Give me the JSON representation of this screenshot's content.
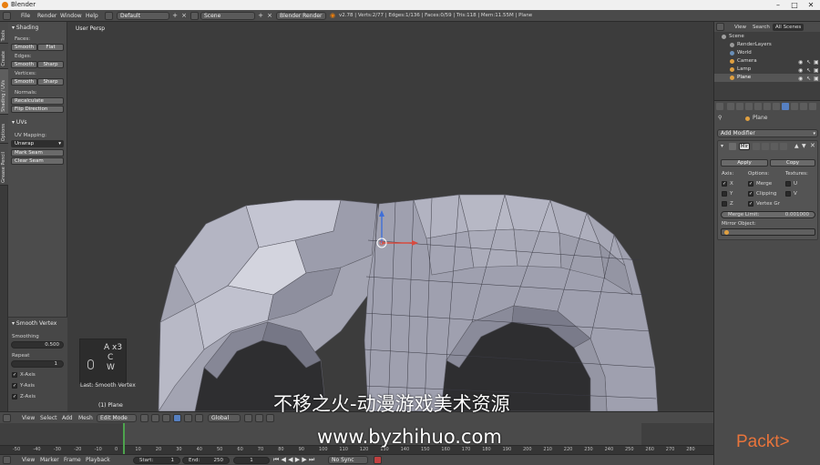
{
  "window": {
    "title": "Blender"
  },
  "infobar": {
    "menus": [
      "File",
      "Render",
      "Window",
      "Help"
    ],
    "layout": "Default",
    "scene": "Scene",
    "engine": "Blender Render",
    "stats": "v2.78 | Verts:2/77 | Edges:1/136 | Faces:0/59 | Tris:118 | Mem:11.55M | Plane"
  },
  "left_tabs": [
    "Tools",
    "Create",
    "Shading / UVs",
    "Options",
    "Grease Pencil"
  ],
  "toolshelf": {
    "shading_header": "Shading",
    "faces_label": "Faces:",
    "faces_smooth": "Smooth",
    "faces_flat": "Flat",
    "edges_label": "Edges:",
    "edges_smooth": "Smooth",
    "edges_sharp": "Sharp",
    "vertices_label": "Vertices:",
    "vertices_smooth": "Smooth",
    "vertices_sharp": "Sharp",
    "normals_label": "Normals:",
    "recalculate": "Recalculate",
    "flip_direction": "Flip Direction",
    "uvs_header": "UVs",
    "uv_mapping_label": "UV Mapping:",
    "unwrap": "Unwrap",
    "mark_seam": "Mark Seam",
    "clear_seam": "Clear Seam",
    "operator_header": "Smooth Vertex",
    "smoothing_label": "Smoothing",
    "smoothing_value": "0.500",
    "repeat_label": "Repeat",
    "repeat_value": "1",
    "x_axis": "X-Axis",
    "y_axis": "Y-Axis",
    "z_axis": "Z-Axis"
  },
  "viewport": {
    "view_name": "User Persp",
    "object_name": "(1) Plane",
    "keys": [
      "A x3",
      "C",
      "W"
    ],
    "last_op": "Last: Smooth Vertex"
  },
  "viewport_header": {
    "view": "View",
    "select": "Select",
    "add": "Add",
    "mesh": "Mesh",
    "mode": "Edit Mode",
    "orientation": "Global"
  },
  "timeline": {
    "ticks": [
      "-50",
      "-40",
      "-30",
      "-20",
      "-10",
      "0",
      "10",
      "20",
      "30",
      "40",
      "50",
      "60",
      "70",
      "80",
      "90",
      "100",
      "110",
      "120",
      "130",
      "140",
      "150",
      "160",
      "170",
      "180",
      "190",
      "200",
      "210",
      "220",
      "230",
      "240",
      "250",
      "260",
      "270",
      "280"
    ]
  },
  "timeline_header": {
    "view": "View",
    "marker": "Marker",
    "frame": "Frame",
    "playback": "Playback",
    "start": "Start:",
    "start_value": "1",
    "end": "End:",
    "end_value": "250",
    "current": "1",
    "sync": "No Sync"
  },
  "outliner": {
    "tabs": [
      "View",
      "Search",
      "All Scenes"
    ],
    "items": [
      {
        "label": "Scene",
        "color": "#a0a0a0"
      },
      {
        "label": "RenderLayers",
        "color": "#9a9a9a"
      },
      {
        "label": "World",
        "color": "#6a8fb8"
      },
      {
        "label": "Camera",
        "color": "#e0a040"
      },
      {
        "label": "Lamp",
        "color": "#e0a040"
      },
      {
        "label": "Plane",
        "color": "#e0a040"
      }
    ]
  },
  "properties": {
    "object": "Plane",
    "add_modifier": "Add Modifier",
    "modifier_name": "Mir",
    "apply": "Apply",
    "copy": "Copy",
    "axis_label": "Axis:",
    "options_label": "Options:",
    "textures_label": "Textures:",
    "axes": [
      "X",
      "Y",
      "Z"
    ],
    "options": [
      "Merge",
      "Clipping",
      "Vertex Gr"
    ],
    "textures": [
      "U",
      "V"
    ],
    "merge_limit_label": "Merge Limit:",
    "merge_limit_value": "0.001000",
    "mirror_object_label": "Mirror Object:"
  },
  "watermark": {
    "line1": "不移之火-动漫游戏美术资源",
    "line2": "www.byzhihuo.com",
    "brand": "Packt>"
  }
}
